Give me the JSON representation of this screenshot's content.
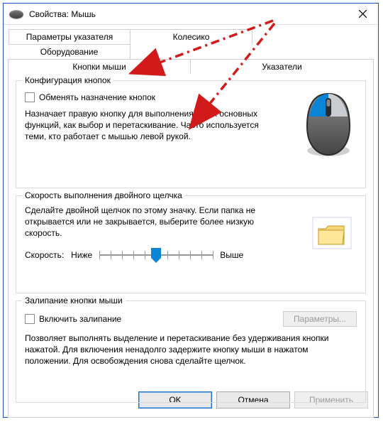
{
  "window": {
    "title": "Свойства: Мышь",
    "close_label": "✕"
  },
  "tabs": {
    "row1": [
      {
        "id": "pointer-options",
        "label": "Параметры указателя"
      },
      {
        "id": "wheel",
        "label": "Колесико"
      },
      {
        "id": "hardware",
        "label": "Оборудование"
      }
    ],
    "row2": [
      {
        "id": "buttons",
        "label": "Кнопки мыши",
        "active": true
      },
      {
        "id": "pointers",
        "label": "Указатели"
      }
    ]
  },
  "config_group": {
    "legend": "Конфигурация кнопок",
    "checkbox_label": "Обменять назначение кнопок",
    "checkbox_checked": false,
    "description": "Назначает правую кнопку для выполнения таких основных функций, как выбор и перетаскивание. Часто используется теми, кто работает с мышью левой рукой."
  },
  "doubleclick_group": {
    "legend": "Скорость выполнения двойного щелчка",
    "description": "Сделайте двойной щелчок по этому значку. Если папка не открывается или не закрывается, выберите более низкую скорость.",
    "speed_label": "Скорость:",
    "low_label": "Ниже",
    "high_label": "Выше",
    "value": 5,
    "max": 10
  },
  "clicklock_group": {
    "legend": "Залипание кнопки мыши",
    "checkbox_label": "Включить залипание",
    "checkbox_checked": false,
    "settings_button": "Параметры...",
    "description": "Позволяет выполнять выделение и перетаскивание без удерживания кнопки нажатой. Для включения ненадолго задержите кнопку мыши в нажатом положении. Для освобождения снова сделайте щелчок."
  },
  "buttons": {
    "ok": "OK",
    "cancel": "Отмена",
    "apply": "Применить"
  }
}
